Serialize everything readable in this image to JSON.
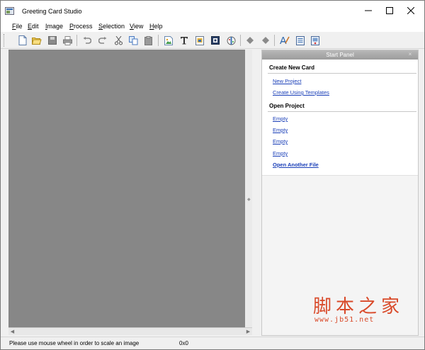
{
  "window": {
    "title": "Greeting Card Studio"
  },
  "menu": [
    {
      "label": "File",
      "u": "F",
      "rest": "ile"
    },
    {
      "label": "Edit",
      "u": "E",
      "rest": "dit"
    },
    {
      "label": "Image",
      "u": "I",
      "rest": "mage"
    },
    {
      "label": "Process",
      "u": "P",
      "rest": "rocess"
    },
    {
      "label": "Selection",
      "u": "S",
      "rest": "election"
    },
    {
      "label": "View",
      "u": "V",
      "rest": "iew"
    },
    {
      "label": "Help",
      "u": "H",
      "rest": "elp"
    }
  ],
  "start_panel": {
    "title": "Start Panel",
    "close": "×",
    "create_title": "Create New Card",
    "create_links": [
      "New Project",
      "Create Using Templates"
    ],
    "open_title": "Open Project",
    "open_links": [
      "Empty",
      "Empty",
      "Empty",
      "Empty"
    ],
    "open_another": "Open Another File"
  },
  "status": {
    "message": "Please use mouse wheel in order to scale an image",
    "coords": "0x0"
  },
  "watermark": {
    "logo": "脚本之家",
    "url": "www.jb51.net"
  },
  "colors": {
    "canvas": "#878787",
    "link": "#1a3fb8",
    "watermark": "#d94a2a"
  }
}
